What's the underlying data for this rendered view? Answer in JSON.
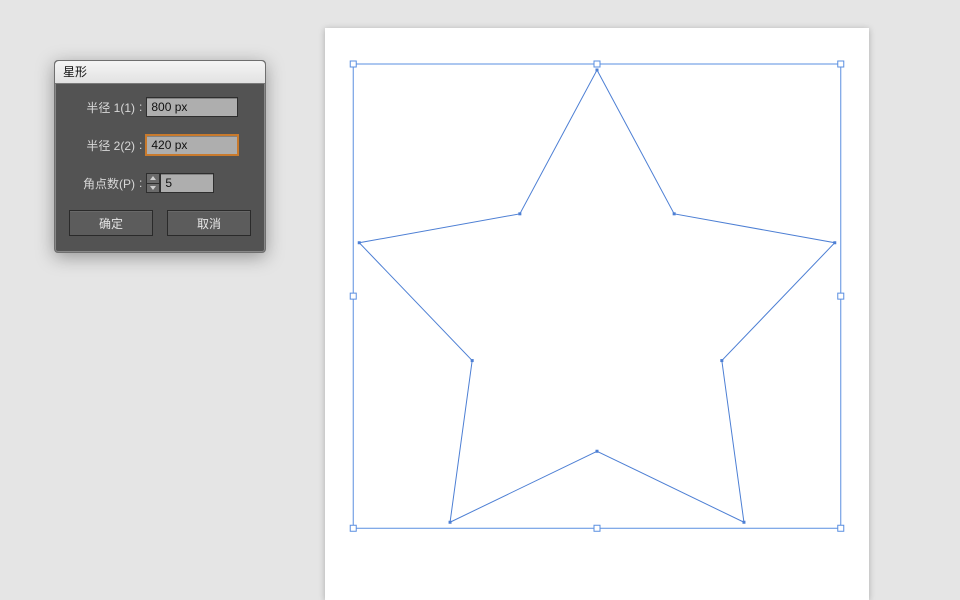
{
  "dialog": {
    "title": "星形",
    "radius1": {
      "label": "半径 1(1)",
      "value": "800 px"
    },
    "radius2": {
      "label": "半径 2(2)",
      "value": "420 px"
    },
    "points": {
      "label": "角点数(P)",
      "value": "5"
    },
    "ok_label": "确定",
    "cancel_label": "取消"
  },
  "shape": {
    "outer_radius": 800,
    "inner_radius": 420,
    "point_count": 5
  },
  "colors": {
    "selection": "#5a8fe0",
    "stroke": "#4d7fd4",
    "panel": "#535353",
    "canvas": "#ffffff",
    "workspace": "#e5e5e5"
  }
}
